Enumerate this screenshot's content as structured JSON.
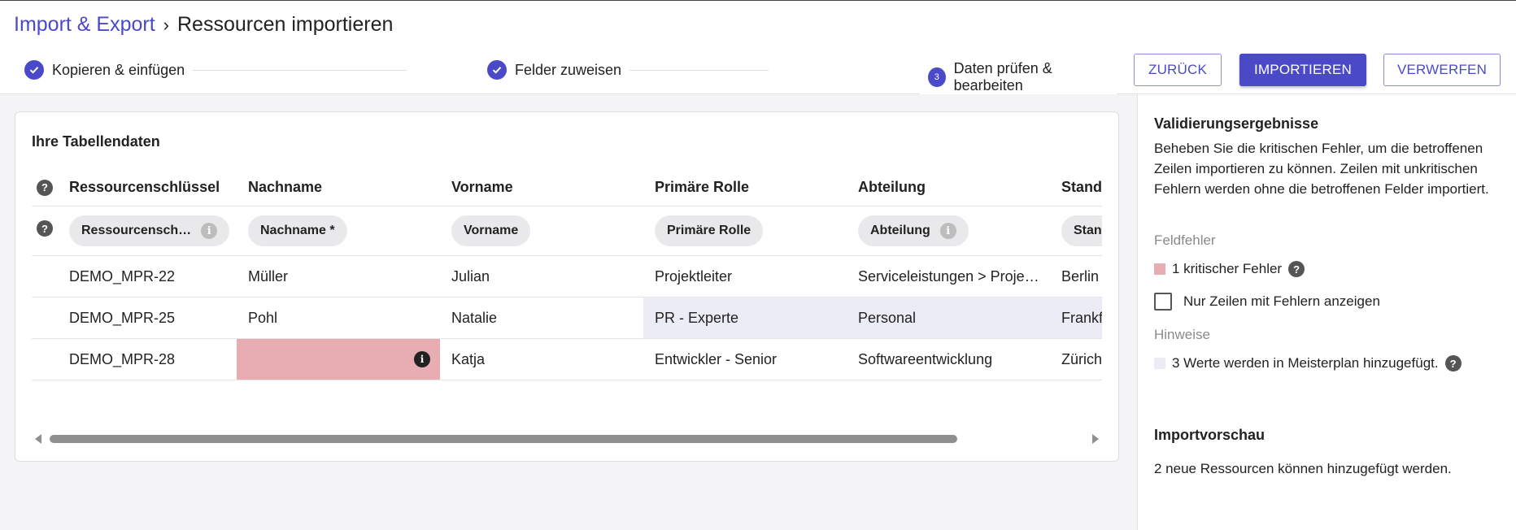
{
  "breadcrumb": {
    "parent": "Import & Export",
    "current": "Ressourcen importieren"
  },
  "steps": [
    {
      "label": "Kopieren & einfügen",
      "icon": "check-icon"
    },
    {
      "label": "Felder zuweisen",
      "icon": "check-icon"
    },
    {
      "label": "Daten prüfen & bearbeiten",
      "number": "3"
    }
  ],
  "buttons": {
    "back": "ZURÜCK",
    "import": "IMPORTIEREN",
    "discard": "VERWERFEN"
  },
  "colors": {
    "accent": "#4a4ac9",
    "error": "#e8adb2",
    "hint": "#ececf6"
  },
  "table": {
    "title": "Ihre Tabellendaten",
    "headers": [
      "Ressourcenschlüssel",
      "Nachname",
      "Vorname",
      "Primäre Rolle",
      "Abteilung",
      "Standort"
    ],
    "mapping": [
      {
        "label": "Ressourcensch…",
        "info": true
      },
      {
        "label": "Nachname *",
        "info": false
      },
      {
        "label": "Vorname",
        "info": false
      },
      {
        "label": "Primäre Rolle",
        "info": false
      },
      {
        "label": "Abteilung",
        "info": true
      },
      {
        "label": "Standort",
        "info": false
      }
    ],
    "rows": [
      [
        "DEMO_MPR-22",
        "Müller",
        "Julian",
        "Projektleiter",
        "Serviceleistungen > Proje…",
        "Berlin"
      ],
      [
        "DEMO_MPR-25",
        "Pohl",
        "Natalie",
        "PR - Experte",
        "Personal",
        "Frankfurt"
      ],
      [
        "DEMO_MPR-28",
        "",
        "Katja",
        "Entwickler - Senior",
        "Softwareentwicklung",
        "Zürich"
      ]
    ]
  },
  "validation": {
    "title": "Validierungsergebnisse",
    "description": "Beheben Sie die kritischen Fehler, um die betroffenen Zeilen importieren zu können. Zeilen mit unkritischen Fehlern werden ohne die betroffenen Felder importiert.",
    "field_errors_label": "Feldfehler",
    "critical_errors": "1 kritischer Fehler",
    "only_error_rows": "Nur Zeilen mit Fehlern anzeigen",
    "hints_label": "Hinweise",
    "hint_text": "3 Werte werden in Meisterplan hinzugefügt."
  },
  "preview": {
    "title": "Importvorschau",
    "text": "2 neue Ressourcen können hinzugefügt werden."
  }
}
